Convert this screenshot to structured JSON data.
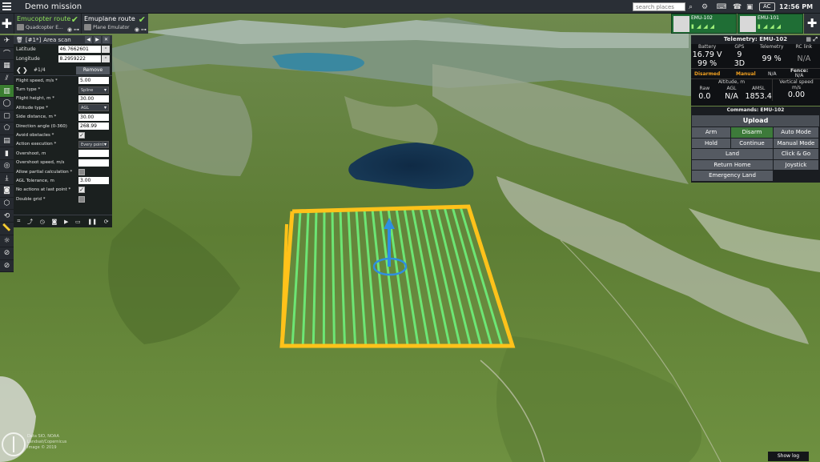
{
  "topbar": {
    "title": "Demo mission",
    "search_placeholder": "search places",
    "ac_label": "AC",
    "clock": "12:56 PM"
  },
  "routes": [
    {
      "name": "Emucopter route",
      "vehicle": "Quadcopter E...",
      "active": true
    },
    {
      "name": "Emuplane route",
      "vehicle": "Plane Emulator",
      "active": false
    }
  ],
  "vehicles": [
    {
      "name": "EMU-102"
    },
    {
      "name": "EMU-101"
    }
  ],
  "scan": {
    "id": "[#1*]",
    "title": "Area scan",
    "latitude_label": "Latitude",
    "latitude": "46.7662601",
    "longitude_label": "Longitude",
    "longitude": "8.2959222",
    "pager": "#1/4",
    "remove": "Remove",
    "params": [
      {
        "label": "Flight speed, m/s *",
        "value": "5.00",
        "kind": "input"
      },
      {
        "label": "Turn type *",
        "value": "Spline",
        "kind": "select"
      },
      {
        "label": "Flight height, m *",
        "value": "30.00",
        "kind": "input"
      },
      {
        "label": "Altitude type *",
        "value": "AGL",
        "kind": "select"
      },
      {
        "label": "Side distance, m *",
        "value": "30.00",
        "kind": "input"
      },
      {
        "label": "Direction angle (0-360)",
        "value": "268.99",
        "kind": "input"
      },
      {
        "label": "Avoid obstacles *",
        "value": "✓",
        "kind": "check-on"
      },
      {
        "label": "Action execution *",
        "value": "Every point",
        "kind": "select"
      },
      {
        "label": "Overshoot, m",
        "value": "",
        "kind": "blank"
      },
      {
        "label": "Overshoot speed, m/s",
        "value": "",
        "kind": "blank"
      },
      {
        "label": "Allow partial calculation *",
        "value": "",
        "kind": "check-off"
      },
      {
        "label": "AGL Tolerance, m",
        "value": "3.00",
        "kind": "input"
      },
      {
        "label": "No actions at last point *",
        "value": "✓",
        "kind": "check-on"
      },
      {
        "label": "Double grid *",
        "value": "",
        "kind": "check-off"
      }
    ]
  },
  "telemetry": {
    "title": "Telemetry: EMU-102",
    "battery_label": "Battery",
    "battery_v": "16.79 V",
    "battery_pct": "99 %",
    "gps_label": "GPS",
    "gps_sats": "9",
    "gps_fix": "3D",
    "telemetry_label": "Telemetry",
    "telemetry_val": "99 %",
    "rc_label": "RC link",
    "rc_val": "N/A",
    "armed_state": "Disarmed",
    "mode": "Manual",
    "mode_na": "N/A",
    "fence_label": "Fence:",
    "fence_val": "N/A",
    "altitude_label": "Altitude, m",
    "raw_label": "Raw",
    "raw_val": "0.0",
    "agl_label": "AGL",
    "agl_val": "N/A",
    "amsl_label": "AMSL",
    "amsl_val": "1853.4",
    "vs_label": "Vertical speed",
    "vs_unit": "m/s",
    "vs_val": "0.00"
  },
  "commands": {
    "title": "Commands: EMU-102",
    "upload": "Upload",
    "arm": "Arm",
    "disarm": "Disarm",
    "auto_mode": "Auto Mode",
    "hold": "Hold",
    "continue": "Continue",
    "manual_mode": "Manual Mode",
    "land": "Land",
    "click_go": "Click & Go",
    "return_home": "Return Home",
    "joystick": "Joystick",
    "emergency_land": "Emergency Land"
  },
  "bottom": {
    "show_log": "Show log",
    "copyright": "Data SIO, NOAA\nLandsat/Copernicus\nImage © 2019"
  },
  "colors": {
    "route_active": "#8ee25a",
    "vehicle_card": "#1f6e35",
    "status_orange": "#f0a020",
    "grid_green": "#6ef07a",
    "grid_yellow": "#ffc21a",
    "vehicle_blue": "#2f8fe0"
  }
}
